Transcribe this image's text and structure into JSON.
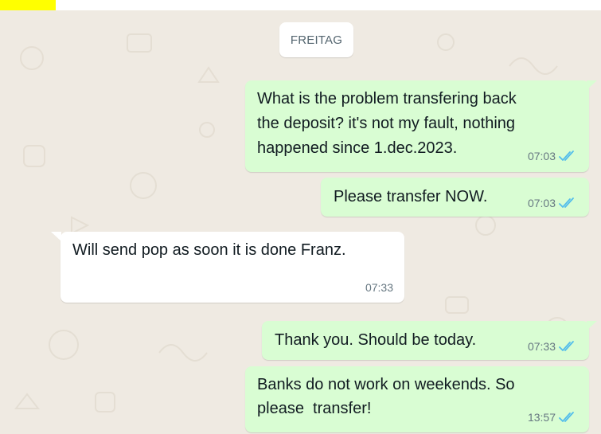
{
  "date_separator": "FREITAG",
  "messages": [
    {
      "direction": "outgoing",
      "lines": [
        "What is the problem transfering back",
        "the deposit? it's not my fault, nothing",
        "happened since 1.dec.2023."
      ],
      "time": "07:03",
      "status": "read"
    },
    {
      "direction": "outgoing",
      "lines": [
        "Please transfer NOW."
      ],
      "time": "07:03",
      "status": "read"
    },
    {
      "direction": "incoming",
      "lines": [
        "Will send pop as soon it is done Franz."
      ],
      "time": "07:33"
    },
    {
      "direction": "outgoing",
      "lines": [
        "Thank you. Should be today."
      ],
      "time": "07:33",
      "status": "read"
    },
    {
      "direction": "outgoing",
      "lines": [
        "Banks do not work on weekends. So",
        "please  transfer!"
      ],
      "time": "13:57",
      "status": "read"
    }
  ],
  "colors": {
    "chat_background": "#efeae2",
    "outgoing_bubble": "#d9fdd3",
    "incoming_bubble": "#ffffff",
    "read_ticks": "#53bdeb",
    "timestamp": "#667781",
    "top_highlight": "#ffff00"
  },
  "icons": [
    "double-check-icon"
  ]
}
